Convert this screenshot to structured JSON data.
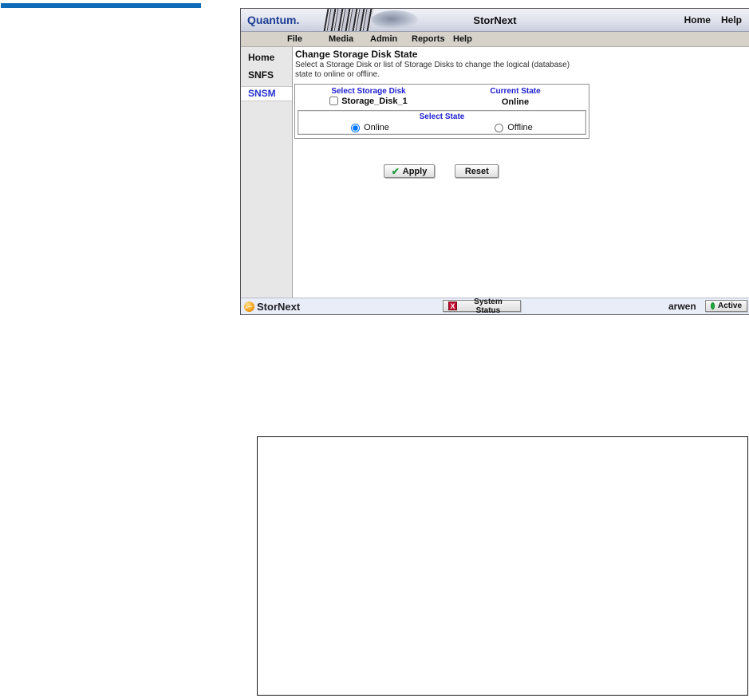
{
  "window": {
    "header": {
      "logo": "Quantum.",
      "title": "StorNext",
      "home_link": "Home",
      "help_link": "Help"
    },
    "menu": {
      "items": [
        {
          "label": "File"
        },
        {
          "label": "Media"
        },
        {
          "label": "Admin"
        },
        {
          "label": "Reports"
        },
        {
          "label": "Help"
        }
      ]
    },
    "sidebar": {
      "items": [
        {
          "label": "Home",
          "selected": false
        },
        {
          "label": "SNFS",
          "selected": false
        },
        {
          "label": "SNSM",
          "selected": true
        }
      ]
    },
    "content": {
      "title": "Change Storage Disk State",
      "description_line1": "Select a Storage Disk or list of Storage Disks to change the logical (database)",
      "description_line2": "state to online or offline.",
      "disk_table": {
        "col_select_header": "Select Storage Disk",
        "col_state_header": "Current State",
        "row": {
          "disk_name": "Storage_Disk_1",
          "checked": false,
          "current_state": "Online"
        },
        "select_state": {
          "label": "Select State",
          "options": [
            {
              "label": "Online",
              "selected": true
            },
            {
              "label": "Offline",
              "selected": false
            }
          ]
        }
      },
      "apply_label": "Apply",
      "reset_label": "Reset",
      "apply_icon": "✔"
    },
    "footer": {
      "brand": "StorNext",
      "system_status_label": "System Status",
      "status_icon_glyph": "X",
      "user": "arwen",
      "active_label": "Active"
    },
    "colors": {
      "accent_link_blue": "#2020d0",
      "top_rule_blue": "#0e6cb6",
      "status_error_red": "#c00a2d",
      "active_green": "#1fae3d",
      "quantum_navy": "#1d3d93"
    }
  }
}
